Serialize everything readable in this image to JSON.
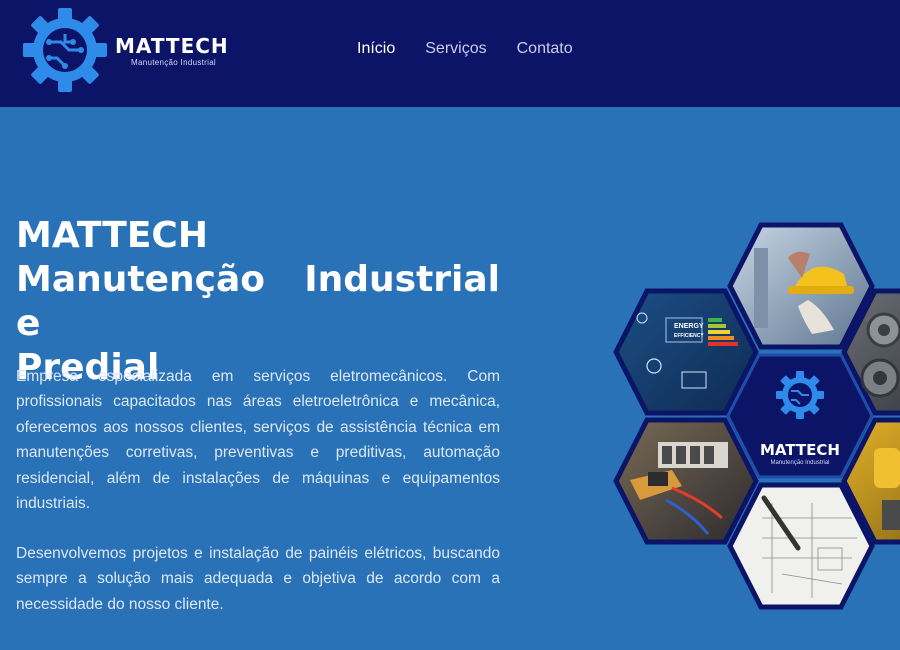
{
  "brand": {
    "name": "MATTECH",
    "tagline": "Manutenção Industrial"
  },
  "nav": {
    "items": [
      {
        "label": "Início",
        "active": true
      },
      {
        "label": "Serviços",
        "active": false
      },
      {
        "label": "Contato",
        "active": false
      }
    ]
  },
  "hero": {
    "title_line1": "MATTECH",
    "title_line2": "Manutenção Industrial e",
    "title_line3": "Predial",
    "paragraph1": "Empresa especializada em serviços eletromecânicos. Com profissionais capacitados nas áreas eletroeletrônica e mecânica, oferecemos aos nossos clientes, serviços de assistência técnica em manutenções corretivas, preventivas e preditivas, automação residencial, além de instalações de máquinas e equipamentos industriais.",
    "paragraph2": "Desenvolvemos projetos e instalação de painéis elétricos, buscando sempre a solução mais adequada e objetiva de acordo com a necessidade do nosso cliente."
  },
  "collage": {
    "center_name": "MATTECH",
    "center_tagline": "Manutenção Industrial",
    "energy_label_1": "ENERGY",
    "energy_label_2": "EFFICIENCY"
  },
  "colors": {
    "header_bg": "#0b1466",
    "page_bg": "#2a72b8",
    "hex_border": "#0b1466",
    "accent": "#2f8bea"
  }
}
